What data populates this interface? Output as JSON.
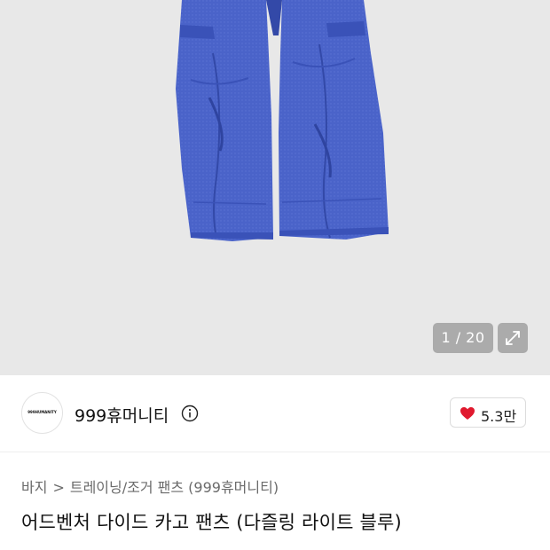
{
  "gallery": {
    "counter": "1 / 20",
    "expand_icon": "expand-arrows-icon"
  },
  "shop": {
    "logo_text": "999HUMANITY",
    "name": "999휴머니티",
    "info_icon": "info-circle-icon",
    "likes": "5.3만",
    "heart_icon": "heart-icon",
    "heart_color": "#e0192e"
  },
  "breadcrumb": {
    "category": "바지",
    "subcategory": "트레이닝/조거 팬츠 (999휴머니티)",
    "separator": ">"
  },
  "product": {
    "title": "어드벤처 다이드 카고 팬츠 (다즐링 라이트 블루)"
  },
  "colors": {
    "pants": "#4a63c9",
    "pants_shadow": "#3349a8",
    "photo_bg": "#e8e8e8"
  }
}
